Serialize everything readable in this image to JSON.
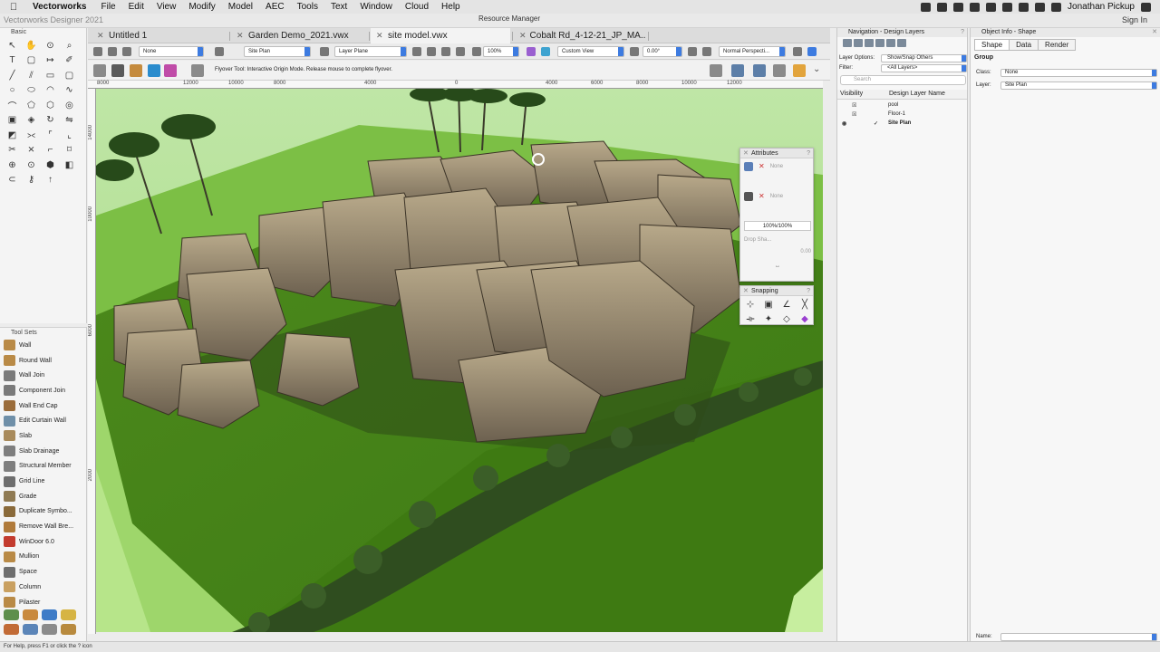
{
  "menubar": {
    "app_name": "Vectorworks",
    "items": [
      "File",
      "Edit",
      "View",
      "Modify",
      "Model",
      "AEC",
      "Tools",
      "Text",
      "Window",
      "Cloud",
      "Help"
    ],
    "user": "Jonathan Pickup"
  },
  "window": {
    "title": "Vectorworks Designer 2021",
    "resource_manager": "Resource Manager",
    "sign_in": "Sign In"
  },
  "tabs": [
    {
      "label": "Untitled 1",
      "active": false
    },
    {
      "label": "Garden Demo_2021.vwx",
      "active": false
    },
    {
      "label": "site model.vwx",
      "active": true
    },
    {
      "label": "Cobalt Rd_4-12-21_JP_MA...",
      "active": false
    }
  ],
  "view_bar": {
    "class_value": "None",
    "layer_value": "Site Plan",
    "plane_value": "Layer Plane",
    "zoom": "100%",
    "view": "Custom View",
    "rotation": "0.00°",
    "render": "Normal Perspecti..."
  },
  "mode_bar": {
    "hint": "Flyover Tool: Interactive Origin Mode. Release mouse to complete flyover."
  },
  "rulers": {
    "top": [
      "8000",
      "12000",
      "10000",
      "8000",
      "4000",
      "0",
      "4000",
      "6000",
      "8000",
      "10000",
      "12000"
    ],
    "left": [
      "14000",
      "10000",
      "6000",
      "2000"
    ]
  },
  "palettes": {
    "basic_title": "Basic",
    "toolsets_title": "Tool Sets",
    "tool_sets": [
      {
        "label": "Wall",
        "color": "#b98a46"
      },
      {
        "label": "Round Wall",
        "color": "#b98a46"
      },
      {
        "label": "Wall Join",
        "color": "#7a7a7a"
      },
      {
        "label": "Component Join",
        "color": "#7a7a7a"
      },
      {
        "label": "Wall End Cap",
        "color": "#9a6c3a"
      },
      {
        "label": "Edit Curtain Wall",
        "color": "#6f8fa8"
      },
      {
        "label": "Slab",
        "color": "#a88a5b"
      },
      {
        "label": "Slab Drainage",
        "color": "#7e7e7e"
      },
      {
        "label": "Structural Member",
        "color": "#7e7e7e"
      },
      {
        "label": "Grid Line",
        "color": "#6e6e6e"
      },
      {
        "label": "Grade",
        "color": "#8f7a52"
      },
      {
        "label": "Duplicate Symbo...",
        "color": "#8a6a3a"
      },
      {
        "label": "Remove Wall Bre...",
        "color": "#b07a3a"
      },
      {
        "label": "WinDoor 6.0",
        "color": "#c33b2e"
      },
      {
        "label": "Mullion",
        "color": "#b98a46"
      },
      {
        "label": "Space",
        "color": "#6e6e6e"
      },
      {
        "label": "Column",
        "color": "#c9a060"
      },
      {
        "label": "Pilaster",
        "color": "#b98a46"
      }
    ]
  },
  "attributes": {
    "title": "Attributes",
    "fill": "None",
    "pen": "None",
    "opacity": "100%/100%",
    "drop_shadow": "Drop Sha...",
    "value": "0.00"
  },
  "snapping": {
    "title": "Snapping"
  },
  "navigation": {
    "title": "Navigation - Design Layers",
    "layer_options_label": "Layer Options:",
    "layer_options_value": "Show/Snap Others",
    "filter_label": "Filter:",
    "filter_value": "<All Layers>",
    "search_placeholder": "Search",
    "col_visibility": "Visibility",
    "col_name": "Design Layer Name",
    "layers": [
      "pool",
      "Floor-1",
      "Site Plan"
    ]
  },
  "object_info": {
    "title": "Object Info - Shape",
    "tabs": [
      "Shape",
      "Data",
      "Render"
    ],
    "type": "Group",
    "class_label": "Class:",
    "class_value": "None",
    "layer_label": "Layer:",
    "layer_value": "Site Plan",
    "name_label": "Name:"
  },
  "status": {
    "text": "For Help, press F1 or click the ? icon"
  }
}
